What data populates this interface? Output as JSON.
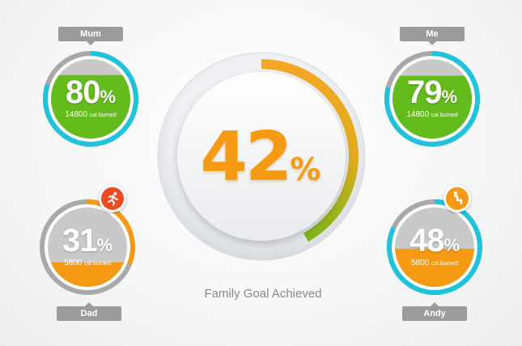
{
  "family_goal": {
    "percent_value": "42",
    "percent_symbol": "%",
    "caption": "Family Goal Achieved",
    "fraction": 0.42
  },
  "members": {
    "mum": {
      "name": "Mum",
      "percent_value": "80",
      "percent_symbol": "%",
      "cal_value": "14800",
      "cal_unit": "cal burned",
      "fraction": 0.8,
      "ring_progress": 0.8,
      "fill_color": "#64bc1c",
      "ring_color": "#1ec3dc"
    },
    "me": {
      "name": "Me",
      "percent_value": "79",
      "percent_symbol": "%",
      "cal_value": "14800",
      "cal_unit": "cal burned",
      "fraction": 0.79,
      "ring_progress": 0.79,
      "fill_color": "#64bc1c",
      "ring_color": "#1ec3dc"
    },
    "dad": {
      "name": "Dad",
      "percent_value": "31",
      "percent_symbol": "%",
      "cal_value": "5800",
      "cal_unit": "cal burned",
      "fraction": 0.31,
      "ring_progress": 0.31,
      "fill_color": "#f59a12",
      "ring_color": "#f59a12",
      "badge_icon": "running-person-icon",
      "badge_color": "#ee4a23"
    },
    "andy": {
      "name": "Andy",
      "percent_value": "48",
      "percent_symbol": "%",
      "cal_value": "5800",
      "cal_unit": "cal burned",
      "fraction": 0.48,
      "ring_progress": 0.82,
      "fill_color": "#f59a12",
      "ring_color": "#1ec3dc",
      "badge_icon": "info-person-icon",
      "badge_color": "#f59a12"
    }
  },
  "colors": {
    "track_gray": "#a9a9a9",
    "inner_gray": "#c9c9c9",
    "goal_orange": "#f59a12",
    "goal_green": "#8cb81c"
  }
}
